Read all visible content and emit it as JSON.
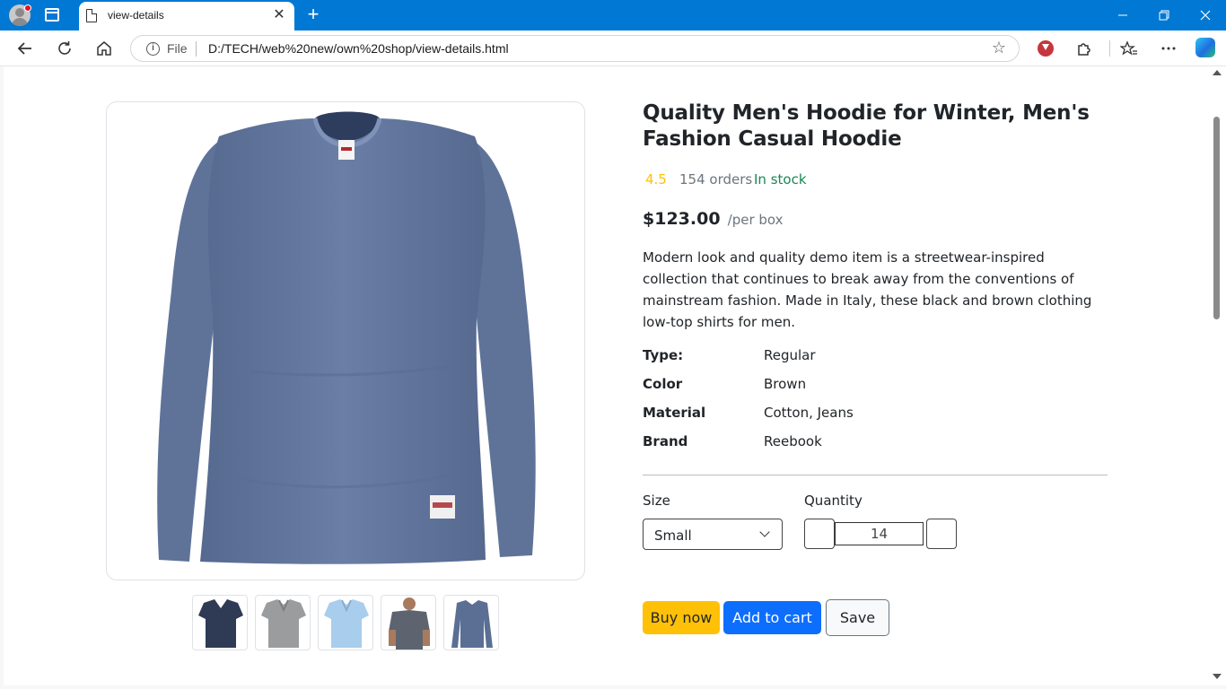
{
  "browser": {
    "tab_title": "view-details",
    "file_label": "File",
    "url": "D:/TECH/web%20new/own%20shop/view-details.html",
    "tab_close_glyph": "✕",
    "new_tab_glyph": "+"
  },
  "product": {
    "title": "Quality Men's Hoodie for Winter, Men's Fashion Casual Hoodie",
    "rating": "4.5",
    "orders": "154 orders",
    "stock": "In stock",
    "price": "$123.00",
    "price_unit": "/per box",
    "description": "Modern look and quality demo item is a streetwear-inspired collection that continues to break away from the conventions of mainstream fashion. Made in Italy, these black and brown clothing low-top shirts for men.",
    "specs": [
      {
        "key": "Type:",
        "value": "Regular"
      },
      {
        "key": "Color",
        "value": "Brown"
      },
      {
        "key": "Material",
        "value": "Cotton, Jeans"
      },
      {
        "key": "Brand",
        "value": "Reebook"
      }
    ],
    "size_label": "Size",
    "size_value": "Small",
    "quantity_label": "Quantity",
    "quantity_value": "14",
    "buy_label": "Buy now",
    "cart_label": "Add to cart",
    "save_label": "Save"
  },
  "thumbnails": [
    {
      "name": "navy-vneck-tshirt",
      "color": "#2f3b55"
    },
    {
      "name": "grey-polo",
      "color": "#9a9c9e"
    },
    {
      "name": "light-blue-polo",
      "color": "#a9cdec"
    },
    {
      "name": "man-grey-polo",
      "color": "#5d6470"
    },
    {
      "name": "blue-longsleeve",
      "color": "#5b6f95"
    }
  ],
  "colors": {
    "accent_blue": "#0d6efd",
    "buy_yellow": "#ffc107",
    "stock_green": "#198754",
    "rating_yellow": "#ffc107",
    "shirt_blue": "#6a7ea6",
    "chrome_blue": "#0078d4"
  },
  "icons": {
    "back": "back-arrow-icon",
    "refresh": "refresh-icon",
    "home": "home-icon",
    "favorite": "star-icon",
    "extensions": "puzzle-icon",
    "favorites_bar": "favorites-icon",
    "menu": "more-icon"
  }
}
